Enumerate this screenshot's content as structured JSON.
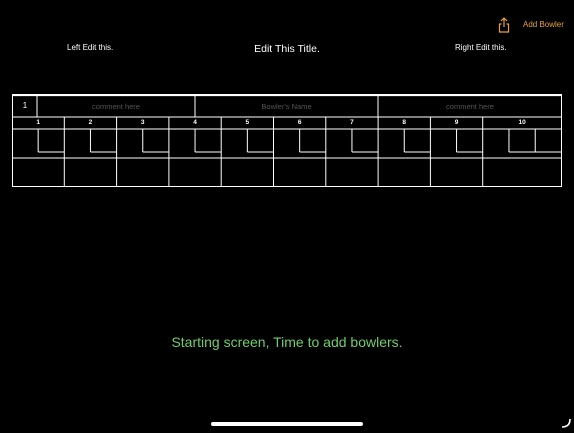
{
  "toolbar": {
    "share_icon": "share-icon",
    "add_bowler_label": "Add Bowler",
    "accent_color": "#e7a33a"
  },
  "header": {
    "left_label": "Left Edit this.",
    "title": "Edit This Title.",
    "right_label": "Right Edit this."
  },
  "scoresheet": {
    "row_number": "1",
    "comment_left_placeholder": "comment here",
    "bowler_name_placeholder": "Bowler's Name",
    "comment_right_placeholder": "comment here",
    "frames": [
      "1",
      "2",
      "3",
      "4",
      "5",
      "6",
      "7",
      "8",
      "9",
      "10"
    ]
  },
  "status": {
    "message": "Starting screen,  Time to add bowlers.",
    "color": "#6fcf6a"
  }
}
